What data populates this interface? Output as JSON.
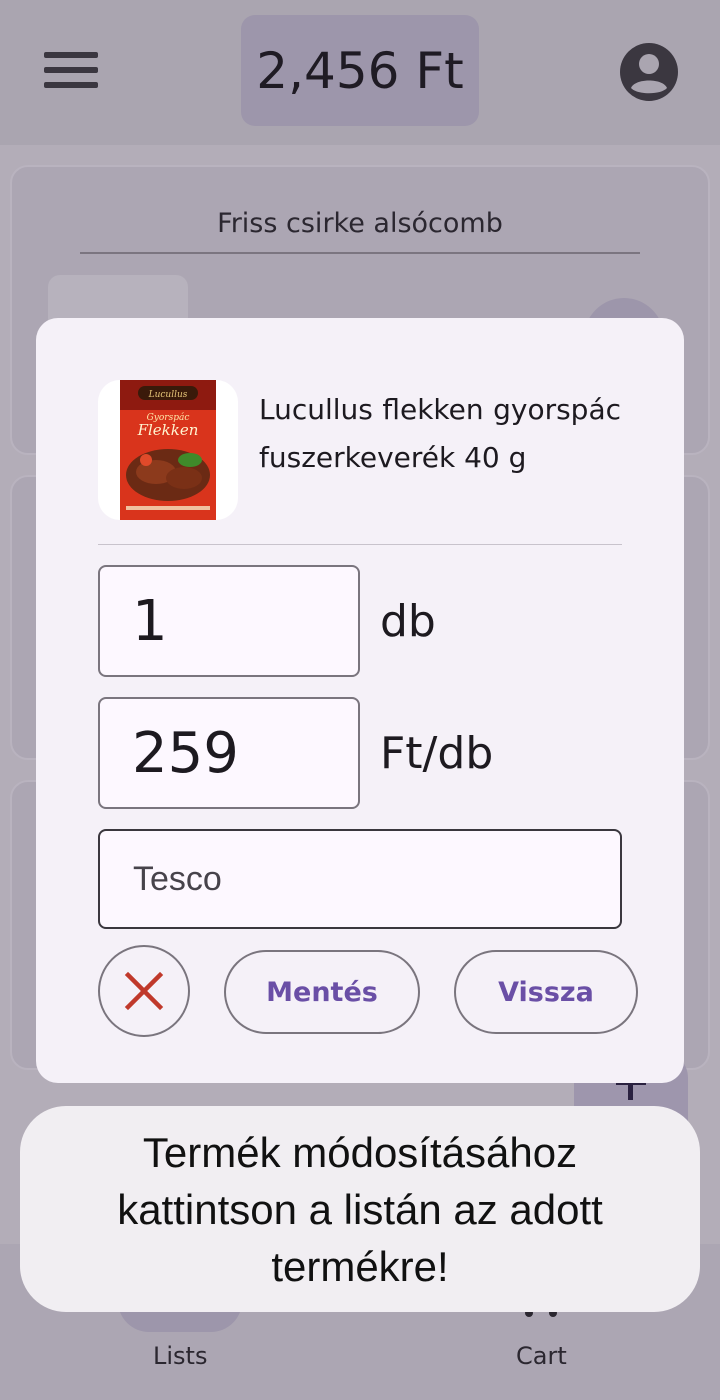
{
  "header": {
    "total": "2,456 Ft",
    "menu_icon": "hamburger-menu-icon",
    "account_icon": "account-circle-icon"
  },
  "background_list": {
    "first_item_title": "Friss csirke alsócomb"
  },
  "dialog": {
    "product_name": "Lucullus flekken gyorspác fuszerkeverék 40 g",
    "thumbnail_brand": "Lucullus",
    "thumbnail_line1": "Gyorspác",
    "thumbnail_line2": "Flekken",
    "quantity_value": "1",
    "quantity_unit": "db",
    "price_value": "259",
    "price_unit": "Ft/db",
    "store_value": "Tesco",
    "delete_icon": "close-x-icon",
    "save_label": "Mentés",
    "back_label": "Vissza"
  },
  "bottom_nav": {
    "items": [
      {
        "label": "Lists",
        "icon": "list-icon",
        "active": true
      },
      {
        "label": "Cart",
        "icon": "cart-icon",
        "active": false
      }
    ]
  },
  "toast": {
    "message": "Termék módosításához kattintson a listán az adott termékre!"
  },
  "colors": {
    "accent": "#6a4fa6",
    "delete": "#c0392b",
    "dialog_bg": "#f5f1f8",
    "scrim": "#aaa5b0"
  }
}
